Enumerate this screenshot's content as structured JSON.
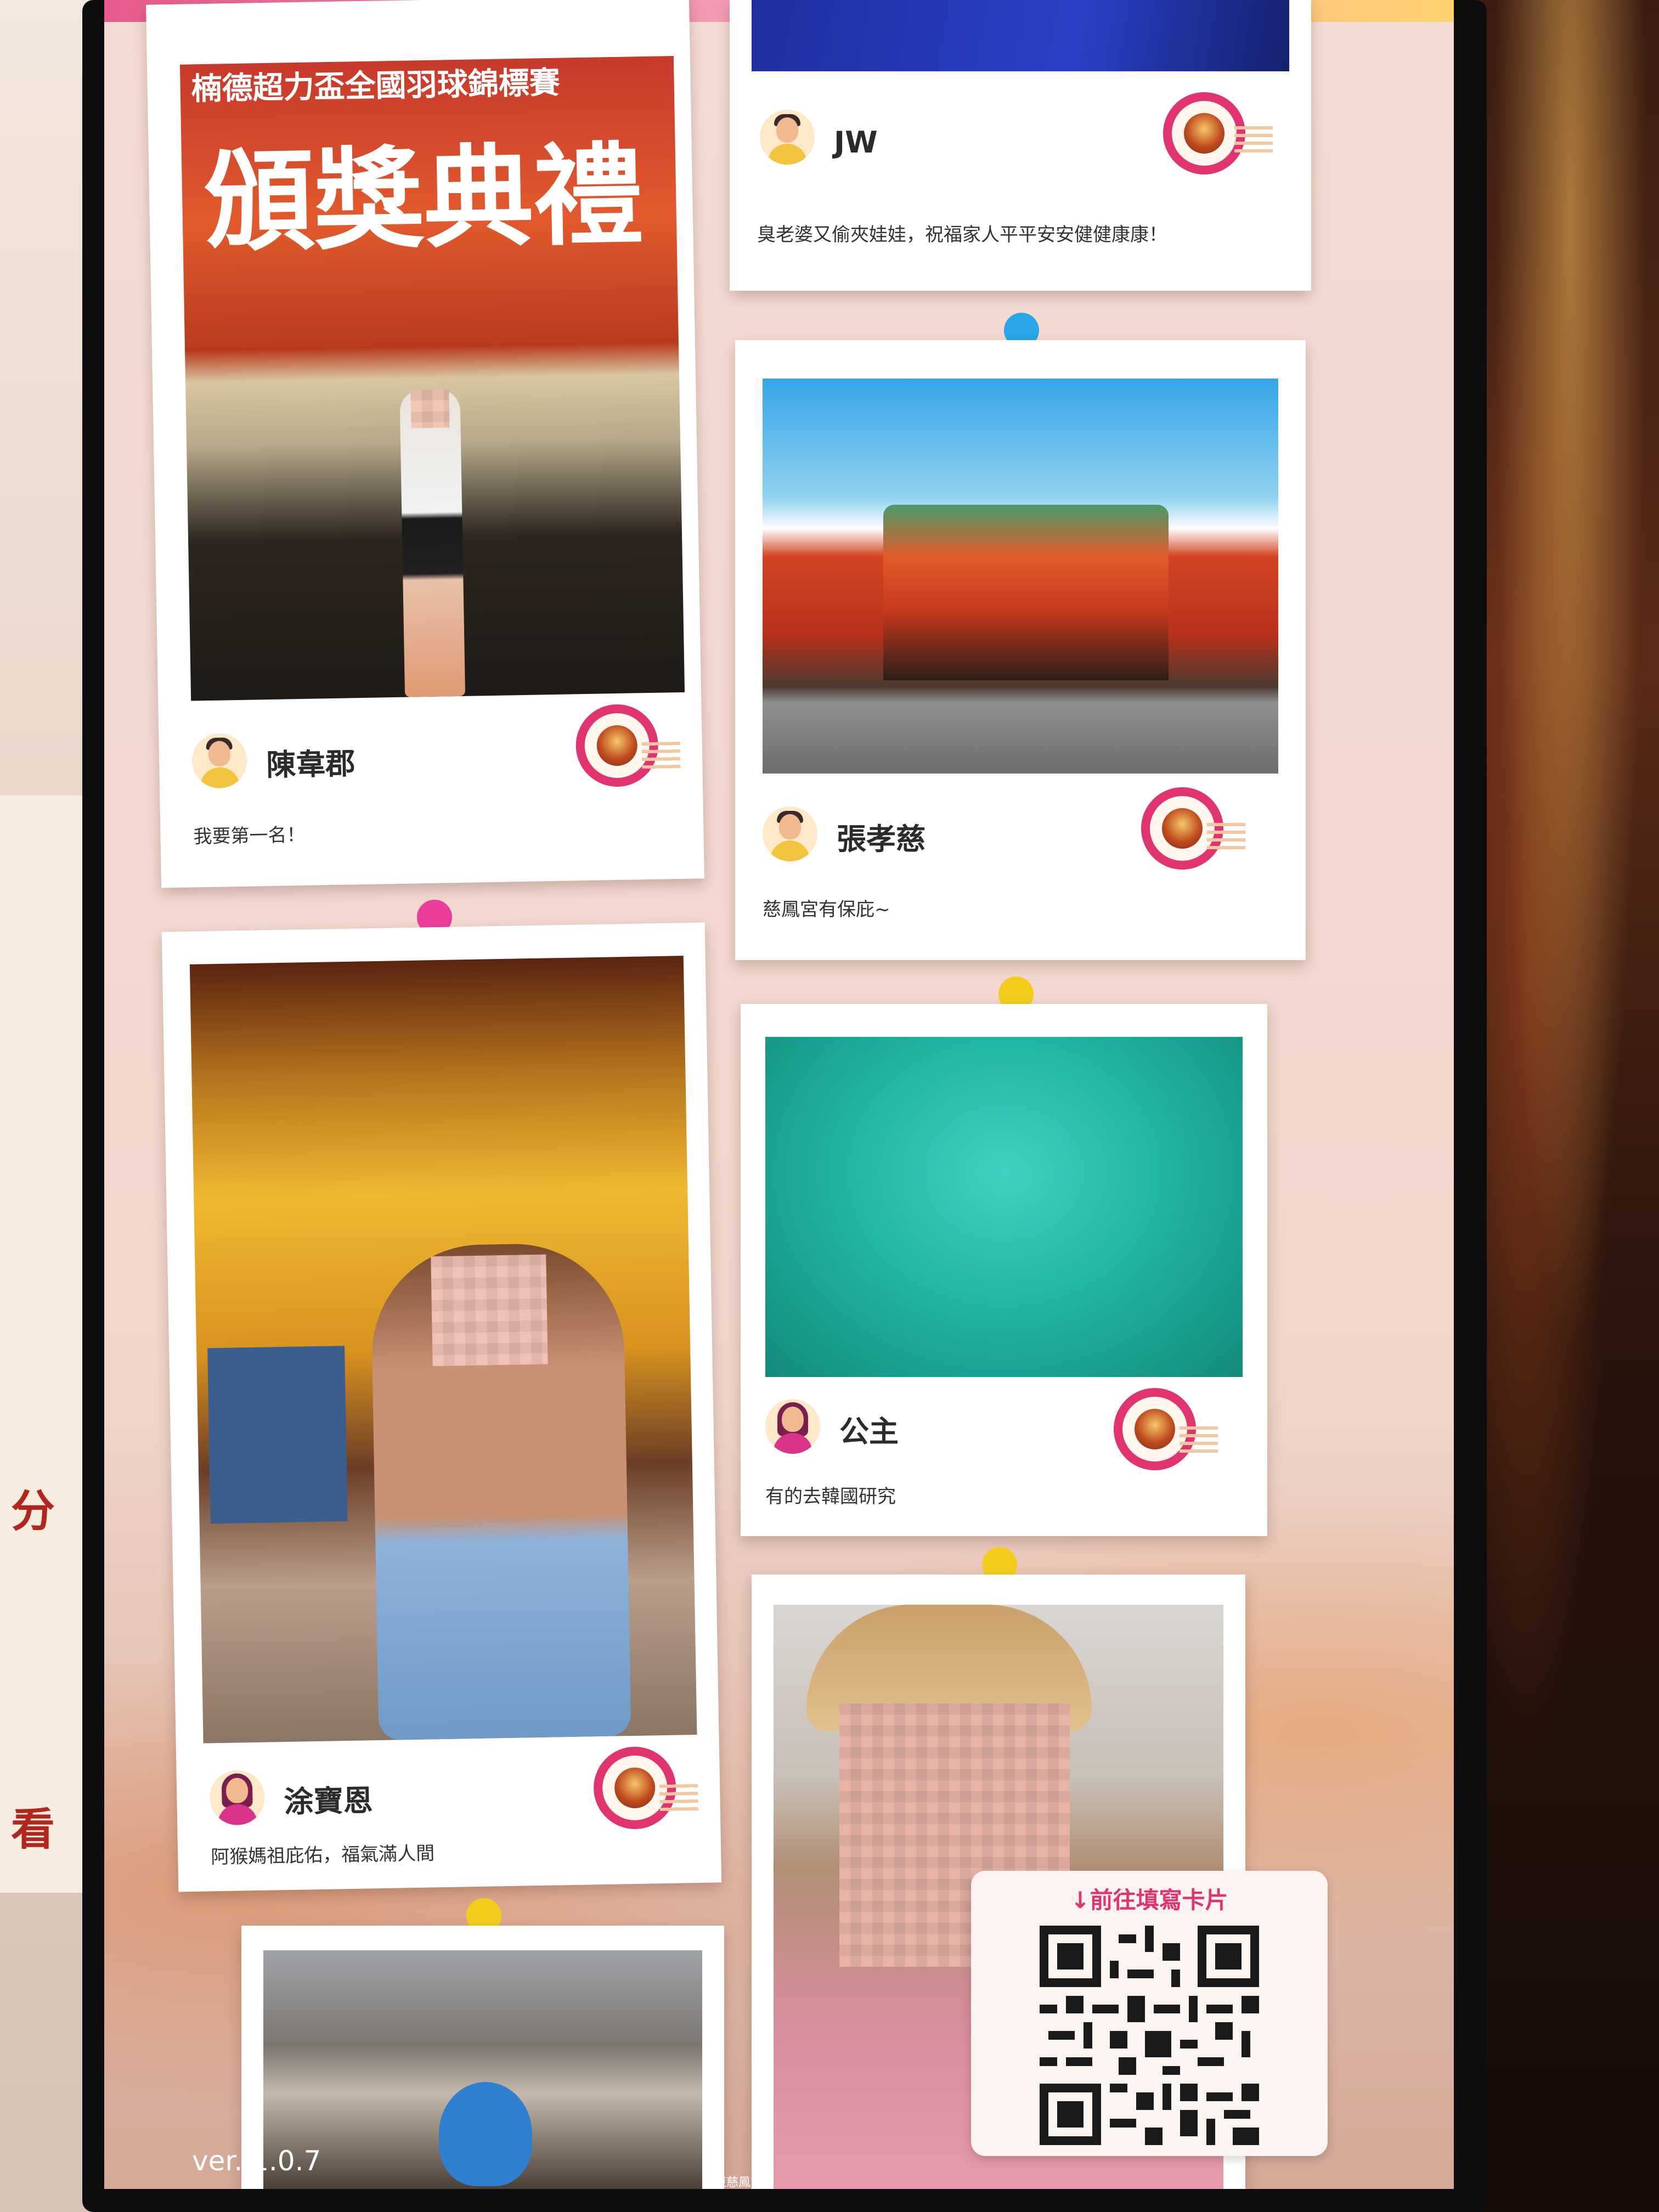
{
  "cards": [
    {
      "name": "JW",
      "message": "臭老婆又偷夾娃娃，祝福家人平平安安健健康康！",
      "avatar": "male-avatar-icon"
    },
    {
      "name": "陳韋郡",
      "message": "我要第一名！",
      "avatar": "male-avatar-icon",
      "photo_caption_line1": "楠德超力盃全國羽球錦標賽",
      "photo_caption_line2": "頒獎典禮"
    },
    {
      "name": "張孝慈",
      "message": "慈鳳宮有保庇~",
      "avatar": "male-avatar-icon"
    },
    {
      "name": "涂寶恩",
      "message": "阿猴媽祖庇佑，福氣滿人間",
      "avatar": "female-avatar-icon"
    },
    {
      "name": "公主",
      "message": "有的去韓國研究",
      "avatar": "female-avatar-icon"
    }
  ],
  "qr": {
    "title": "↓前往填寫卡片"
  },
  "version": "ver. 1.0.7",
  "footer": "屏東慈鳳宮",
  "colors": {
    "accent_pink": "#e0336f",
    "pin_blue": "#2aa6e8",
    "pin_pink": "#ea3d9a",
    "pin_yellow": "#f4cc1c",
    "screen_bg": "#f4dcd3"
  }
}
